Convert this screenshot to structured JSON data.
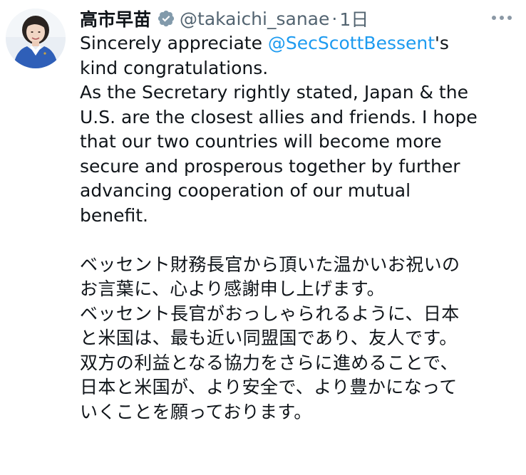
{
  "author": {
    "display_name": "高市早苗",
    "handle": "@takaichi_sanae",
    "separator": "·",
    "time": "1日",
    "verified_icon": "verified-badge-icon",
    "more_icon": "more-horizontal-icon",
    "verified_color": "#829aab"
  },
  "tweet": {
    "english": {
      "line1_before": "Sincerely appreciate ",
      "mention": "@SecScottBessent",
      "line1_after": "'s",
      "lines": [
        "kind congratulations.",
        "As the Secretary rightly stated, Japan & the",
        "U.S. are the closest allies and friends. I hope",
        "that our two countries will become more",
        "secure and prosperous together by further",
        "advancing cooperation of our mutual",
        "benefit."
      ]
    },
    "japanese": {
      "lines": [
        "ベッセント財務長官から頂いた温かいお祝いの",
        "お言葉に、心より感謝申し上げます。",
        "ベッセント長官がおっしゃられるように、日本",
        "と米国は、最も近い同盟国であり、友人です。",
        "双方の利益となる協力をさらに進めることで、",
        "日本と米国が、より安全で、より豊かになって",
        "いくことを願っております。"
      ]
    }
  },
  "colors": {
    "text": "#0f1419",
    "secondary": "#536471",
    "link": "#1d9bf0"
  }
}
